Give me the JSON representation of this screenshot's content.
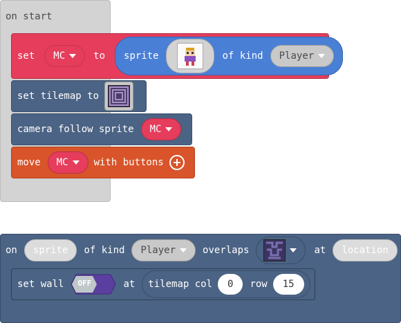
{
  "on_start": {
    "label": "on start"
  },
  "set_block": {
    "set": "set",
    "var": "MC",
    "to": "to",
    "sprite": "sprite",
    "of_kind": "of kind",
    "kind_value": "Player"
  },
  "tilemap_block": {
    "label": "set tilemap to"
  },
  "camera_block": {
    "label": "camera follow sprite",
    "var": "MC"
  },
  "move_block": {
    "move": "move",
    "var": "MC",
    "with_buttons": "with buttons",
    "add_icon": "plus-circle-icon"
  },
  "overlap_event": {
    "on": "on",
    "sprite": "sprite",
    "of_kind": "of kind",
    "kind_value": "Player",
    "overlaps": "overlaps",
    "at": "at",
    "location": "location"
  },
  "wall_block": {
    "set_wall": "set wall",
    "toggle": "OFF",
    "at": "at",
    "tilemap_col": "tilemap col",
    "col_value": "0",
    "row": "row",
    "row_value": "15"
  },
  "colors": {
    "pink": "#e63d5c",
    "steel": "#4b6384",
    "orange": "#d9542a",
    "blue": "#4a7fd6",
    "purple": "#5b3fa0"
  }
}
